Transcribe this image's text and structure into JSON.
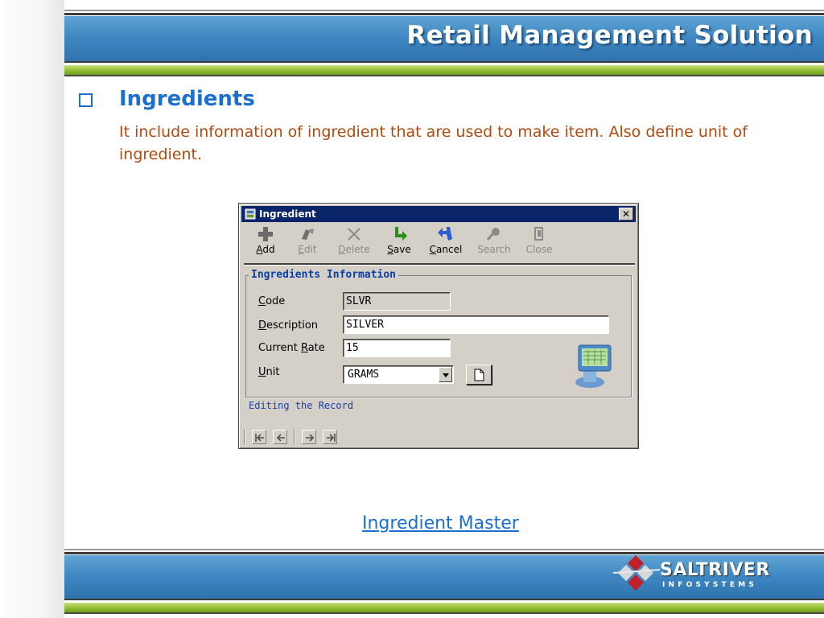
{
  "header": {
    "title": "Retail Management Solution"
  },
  "section": {
    "heading": "Ingredients",
    "description": "It include information of ingredient that are used to make item. Also define unit of ingredient."
  },
  "dialog": {
    "title": "Ingredient",
    "close_label": "✕",
    "toolbar": [
      {
        "key": "A",
        "rest": "dd",
        "label": "Add",
        "icon": "add-icon",
        "enabled": true
      },
      {
        "key": "E",
        "rest": "dit",
        "label": "Edit",
        "icon": "edit-icon",
        "enabled": false
      },
      {
        "key": "D",
        "rest": "elete",
        "label": "Delete",
        "icon": "delete-icon",
        "enabled": false
      },
      {
        "key": "S",
        "rest": "ave",
        "label": "Save",
        "icon": "save-icon",
        "enabled": true
      },
      {
        "key": "C",
        "rest": "ancel",
        "label": "Cancel",
        "icon": "cancel-icon",
        "enabled": true
      },
      {
        "label": "Search",
        "icon": "search-icon",
        "enabled": false
      },
      {
        "label": "Close",
        "icon": "close-door-icon",
        "enabled": false
      }
    ],
    "group_title": "Ingredients Information",
    "fields": {
      "code": {
        "label_key": "C",
        "label_rest": "ode",
        "value": "SLVR"
      },
      "description": {
        "label_key": "D",
        "label_rest": "escription",
        "value": "SILVER"
      },
      "current_rate": {
        "label_pre": "Current ",
        "label_key": "R",
        "label_rest": "ate",
        "value": "15"
      },
      "unit": {
        "label_key": "U",
        "label_rest": "nit",
        "value": "GRAMS"
      }
    },
    "status": "Editing the Record"
  },
  "caption": "Ingredient Master",
  "footer": {
    "logo_main": "SALTRIVER",
    "logo_sub": "INFOSYSTEMS"
  },
  "colors": {
    "accent": "#1a6fcf",
    "body_text": "#b24a10",
    "banner_blue": "#3d86c2",
    "banner_green": "#8fba2e"
  }
}
